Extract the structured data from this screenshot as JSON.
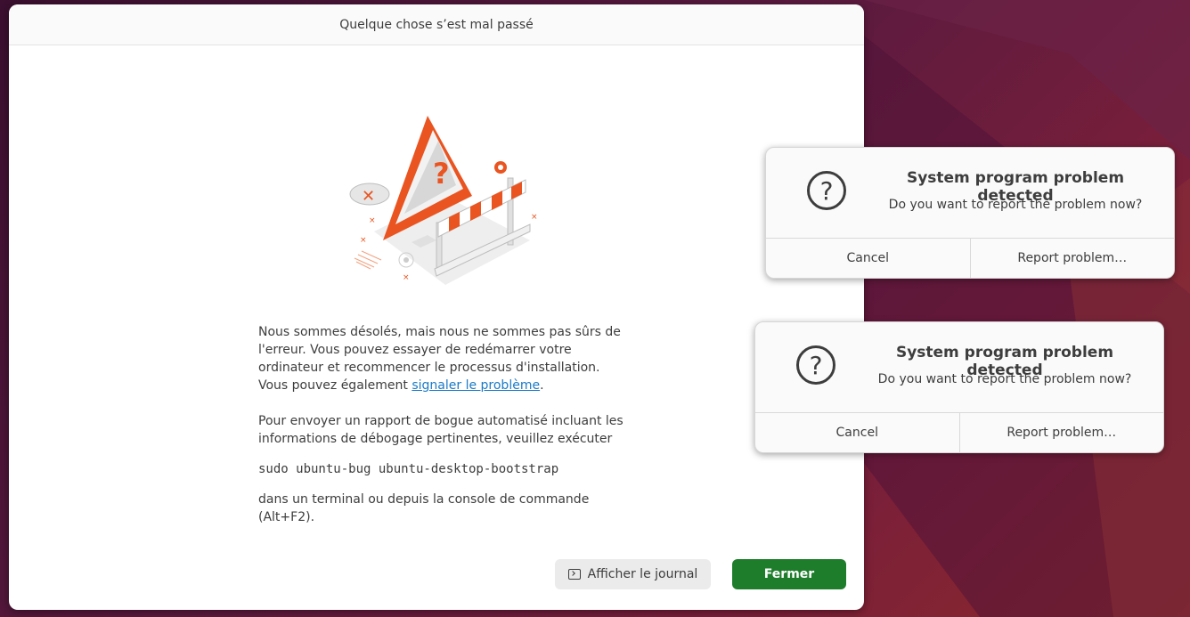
{
  "main_window": {
    "title": "Quelque chose s’est mal passé",
    "paragraph1_before_link": "Nous sommes désolés, mais nous ne sommes pas sûrs de l'erreur. Vous pouvez essayer de redémarrer votre ordinateur et recommencer le processus d'installation. Vous pouvez également ",
    "paragraph1_link": " signaler le problème",
    "paragraph1_after_link": ".",
    "paragraph2": "Pour envoyer un rapport de bogue automatisé incluant les informations de débogage pertinentes, veuillez exécuter",
    "command": "sudo ubuntu-bug ubuntu-desktop-bootstrap",
    "paragraph3": "dans un terminal ou depuis la console de commande (Alt+F2).",
    "show_log_label": "Afficher le journal",
    "close_label": "Fermer"
  },
  "dialogs": [
    {
      "title": "System program problem detected",
      "subtitle": "Do you want to report the problem now?",
      "cancel_label": "Cancel",
      "report_label": "Report problem…"
    },
    {
      "title": "System program problem detected",
      "subtitle": "Do you want to report the problem now?",
      "cancel_label": "Cancel",
      "report_label": "Report problem…"
    }
  ],
  "colors": {
    "accent_orange": "#e95420",
    "primary_green": "#1e7d2b",
    "link_blue": "#1a7ac7"
  }
}
